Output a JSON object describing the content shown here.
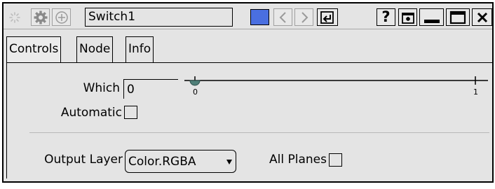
{
  "titlebar": {
    "node_name": "Switch1",
    "swatch_color": "#4a6fe0",
    "help_label": "?"
  },
  "tabs": [
    {
      "label": "Controls"
    },
    {
      "label": "Node"
    },
    {
      "label": "Info"
    }
  ],
  "controls": {
    "which": {
      "label": "Which",
      "value": "0",
      "slider_min": "0",
      "slider_max": "1",
      "slider_value": 0
    },
    "automatic": {
      "label": "Automatic",
      "checked": false
    },
    "output_layer": {
      "label": "Output Layer",
      "value": "Color.RGBA"
    },
    "all_planes": {
      "label": "All Planes",
      "checked": false
    }
  }
}
